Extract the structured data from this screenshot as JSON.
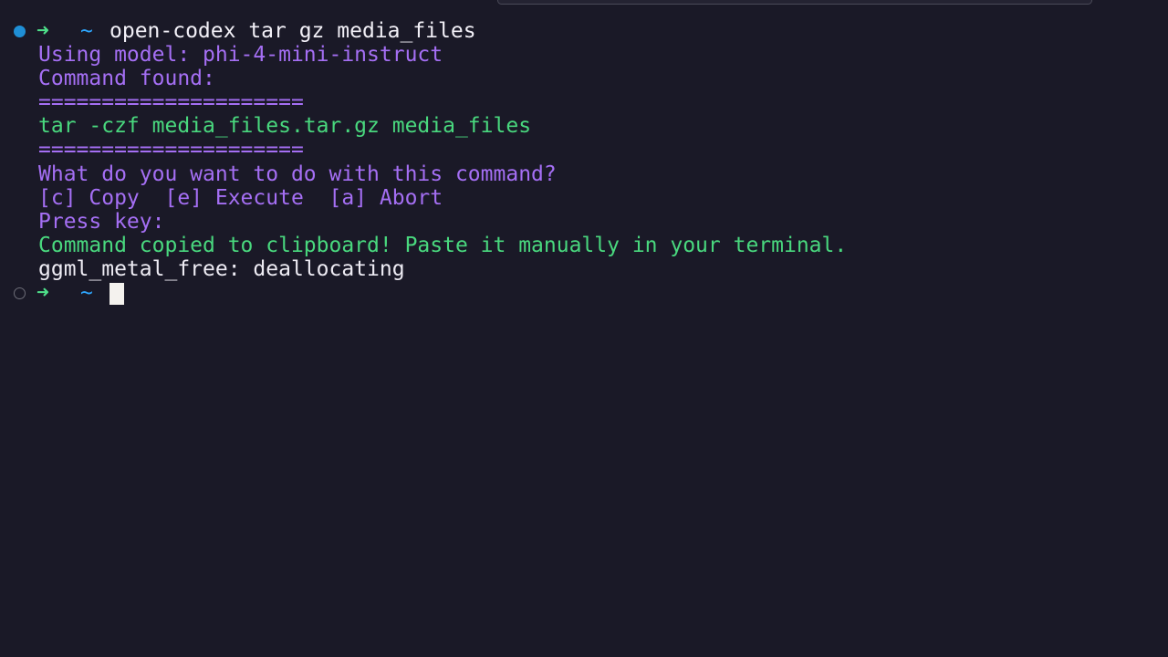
{
  "prompt": {
    "arrow": "➜",
    "dir": "~",
    "command": "open-codex tar gz media_files"
  },
  "output": {
    "model_line": "Using model: phi-4-mini-instruct",
    "found_label": "Command found:",
    "separator_top": "=====================",
    "found_command": "tar -czf media_files.tar.gz media_files",
    "separator_bottom": "=====================",
    "question": "What do you want to do with this command?",
    "options": "[c] Copy  [e] Execute  [a] Abort",
    "press_key": "Press key:",
    "copied_msg": "Command copied to clipboard! Paste it manually in your terminal.",
    "dealloc": "ggml_metal_free: deallocating"
  },
  "prompt2": {
    "arrow": "➜",
    "dir": "~"
  },
  "colors": {
    "background": "#1a1927",
    "purple_text": "#a56ff4",
    "green_text": "#49d87e",
    "arrow": "#4ee08a",
    "tilde": "#2ea7ff",
    "status_dot_active": "#1f8fd6"
  }
}
